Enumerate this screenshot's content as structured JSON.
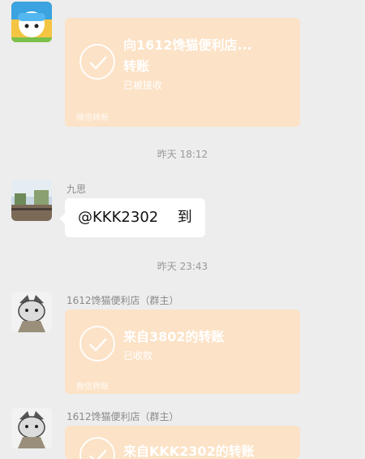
{
  "messages": [
    {
      "transfer": {
        "title_line1": "向1612馋猫便利店...",
        "title_line2": "转账",
        "status": "已被接收",
        "footer": "微信转账"
      }
    },
    {
      "timestamp": "昨天 18:12"
    },
    {
      "sender": "九思",
      "text_mention": "@KKK2302",
      "text_body": "到"
    },
    {
      "timestamp": "昨天 23:43"
    },
    {
      "sender": "1612馋猫便利店（群主）",
      "transfer": {
        "title_line1": "来自3802的转账",
        "status": "已收款",
        "footer": "微信转账"
      }
    },
    {
      "sender": "1612馋猫便利店（群主）",
      "transfer": {
        "title_line1": "来自KKK2302的转账"
      }
    }
  ],
  "colors": {
    "background": "#ededed",
    "transfer_card": "#fce2c6",
    "bubble": "#ffffff"
  },
  "icons": [
    "check-circle-icon"
  ]
}
